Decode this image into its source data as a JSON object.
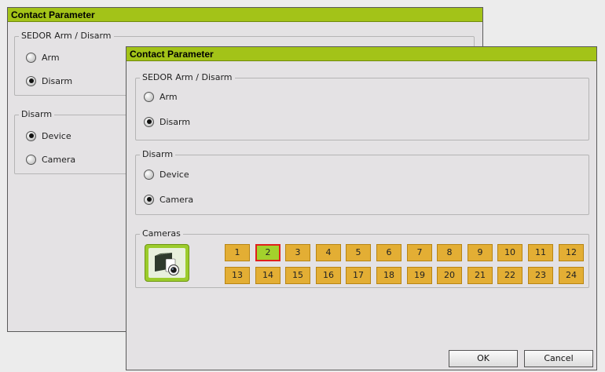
{
  "back_dialog": {
    "title": "Contact Parameter",
    "group1_label": "SEDOR Arm / Disarm",
    "arm_label": "Arm",
    "disarm_label": "Disarm",
    "group2_label": "Disarm",
    "device_label": "Device",
    "camera_label": "Camera",
    "selected_mode": "Disarm",
    "selected_target": "Device"
  },
  "front_dialog": {
    "title": "Contact Parameter",
    "group1_label": "SEDOR Arm / Disarm",
    "arm_label": "Arm",
    "disarm_label": "Disarm",
    "group2_label": "Disarm",
    "device_label": "Device",
    "camera_label": "Camera",
    "selected_mode": "Disarm",
    "selected_target": "Camera",
    "cameras_label": "Cameras",
    "cameras": [
      "1",
      "2",
      "3",
      "4",
      "5",
      "6",
      "7",
      "8",
      "9",
      "10",
      "11",
      "12",
      "13",
      "14",
      "15",
      "16",
      "17",
      "18",
      "19",
      "20",
      "21",
      "22",
      "23",
      "24"
    ],
    "selected_camera": "2",
    "ok_label": "OK",
    "cancel_label": "Cancel"
  },
  "colors": {
    "titlebar": "#a3c318",
    "camera_button": "#e3ae34",
    "camera_selected": "#a3d12c",
    "camera_selected_border": "#e0201c",
    "camera_icon_bg": "#9ccc2c"
  }
}
